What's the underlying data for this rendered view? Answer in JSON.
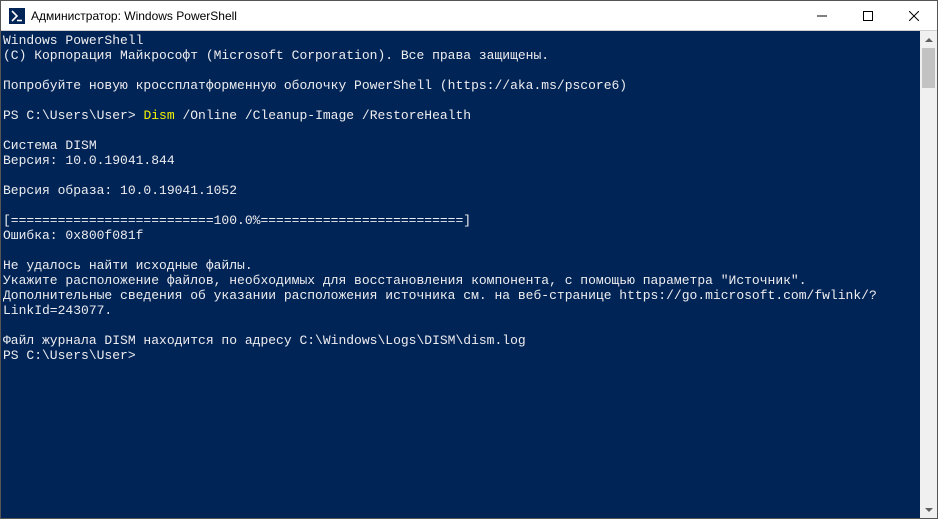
{
  "window": {
    "title": "Администратор: Windows PowerShell"
  },
  "terminal": {
    "line1": "Windows PowerShell",
    "line2": "(С) Корпорация Майкрософт (Microsoft Corporation). Все права защищены.",
    "blank1": "",
    "line3": "Попробуйте новую кроссплатформенную оболочку PowerShell (https://aka.ms/pscore6)",
    "blank2": "",
    "prompt1_prefix": "PS C:\\Users\\User> ",
    "prompt1_cmd": "Dism",
    "prompt1_args": " /Online /Cleanup-Image /RestoreHealth",
    "blank3": "",
    "line4": "Cистема DISM",
    "line5": "Версия: 10.0.19041.844",
    "blank4": "",
    "line6": "Версия образа: 10.0.19041.1052",
    "blank5": "",
    "line7": "[==========================100.0%==========================]",
    "line8": "Ошибка: 0x800f081f",
    "blank6": "",
    "line9": "Не удалось найти исходные файлы.",
    "line10": "Укажите расположение файлов, необходимых для восстановления компонента, с помощью параметра \"Источник\". Дополнительные сведения об указании расположения источника см. на веб-странице https://go.microsoft.com/fwlink/?LinkId=243077.",
    "blank7": "",
    "line11": "Файл журнала DISM находится по адресу C:\\Windows\\Logs\\DISM\\dism.log",
    "prompt2": "PS C:\\Users\\User>"
  }
}
